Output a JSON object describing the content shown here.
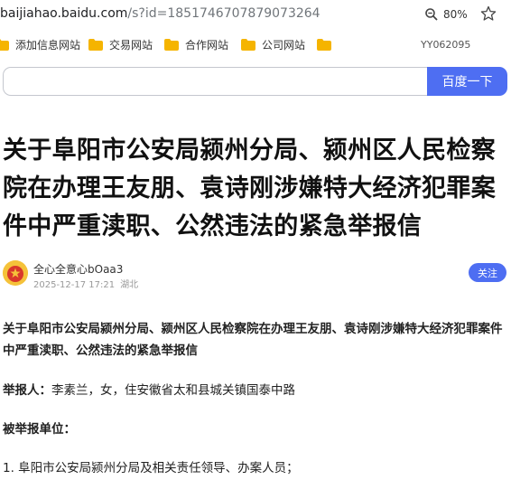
{
  "browser": {
    "url_host": "baijiahao.baidu.com",
    "url_path": "/s?id=1851746707879073264",
    "zoom": "80%"
  },
  "bookmarks": {
    "items": [
      {
        "label": "添加信息网站"
      },
      {
        "label": "交易网站"
      },
      {
        "label": "合作网站"
      },
      {
        "label": "公司网站"
      },
      {
        "label": ""
      }
    ],
    "profile_id": "YY062095"
  },
  "search": {
    "placeholder": "",
    "button_label": "百度一下"
  },
  "article": {
    "title": "关于阜阳市公安局颍州分局、颍州区人民检察院在办理王友朋、袁诗刚涉嫌特大经济犯罪案件中严重渎职、公然违法的紧急举报信",
    "author": "全心全意心bOaa3",
    "datetime": "2025-12-17 17:21",
    "location": "湖北",
    "follow_label": "关注",
    "lead": "关于阜阳市公安局颍州分局、颍州区人民检察院在办理王友朋、袁诗刚涉嫌特大经济犯罪案件中严重渎职、公然违法的紧急举报信",
    "reporter_label": "举报人：",
    "reporter_text": "李素兰，女，住安徽省太和县城关镇国泰中路",
    "reported_label": "被举报单位：",
    "reported_item1": "1. 阜阳市公安局颍州分局及相关责任领导、办案人员；"
  },
  "colors": {
    "accent": "#4e6ef2",
    "folder": "#f5b400"
  }
}
